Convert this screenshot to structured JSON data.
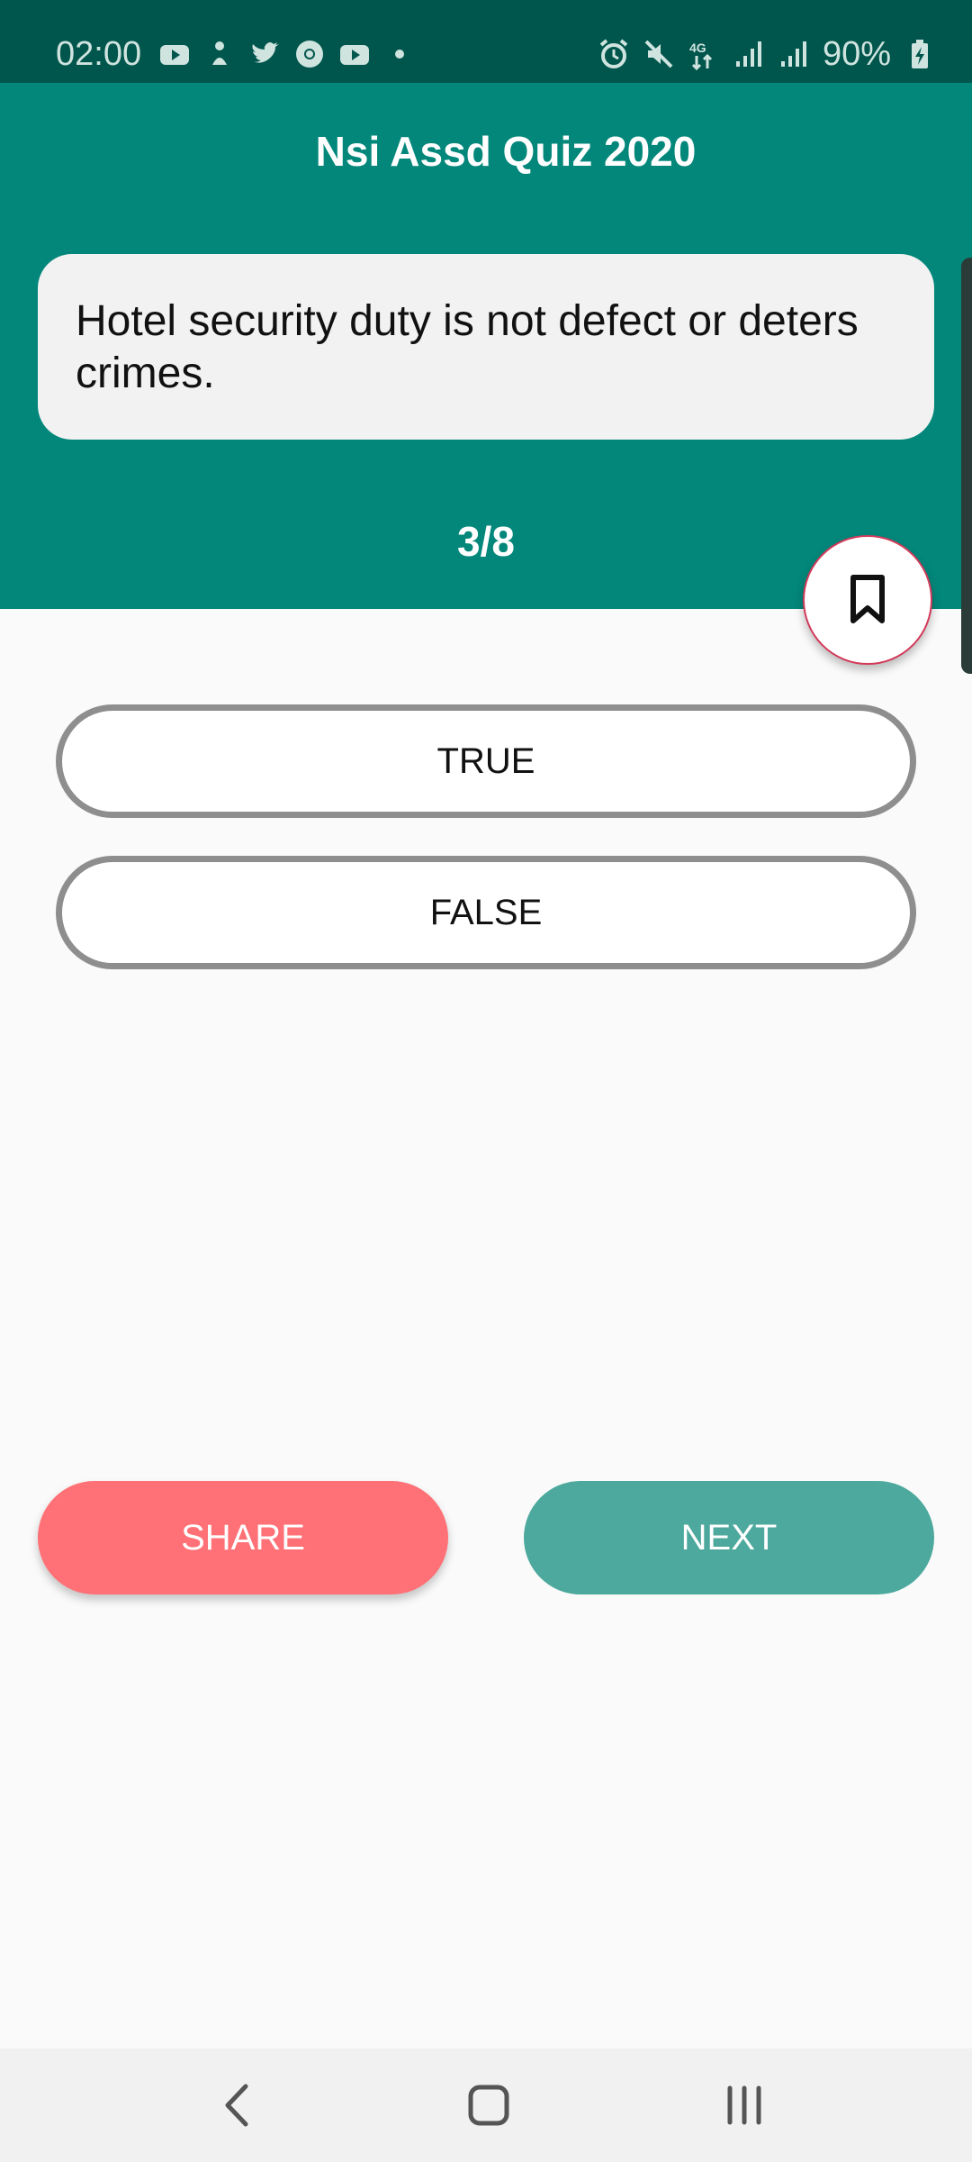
{
  "status_bar": {
    "time": "02:00",
    "battery_text": "90%",
    "left_icons": [
      "youtube-icon",
      "notification-icon",
      "twitter-icon",
      "chrome-icon",
      "youtube-icon",
      "dot-icon"
    ],
    "right_icons": [
      "alarm-icon",
      "mute-icon",
      "4g-icon",
      "signal-icon",
      "signal-icon",
      "battery-charging-icon"
    ]
  },
  "header": {
    "title": "Nsi Assd Quiz 2020",
    "background": "#03877a"
  },
  "question": {
    "text": "Hotel security duty is not defect or deters crimes.",
    "progress": "3/8"
  },
  "bookmark": {
    "icon": "bookmark-icon"
  },
  "answers": {
    "true_label": "TRUE",
    "false_label": "FALSE"
  },
  "actions": {
    "share_label": "SHARE",
    "next_label": "NEXT",
    "share_color": "#ff7176",
    "next_color": "#4da99d"
  },
  "nav": {
    "icons": [
      "back-icon",
      "home-icon",
      "recent-apps-icon"
    ]
  }
}
